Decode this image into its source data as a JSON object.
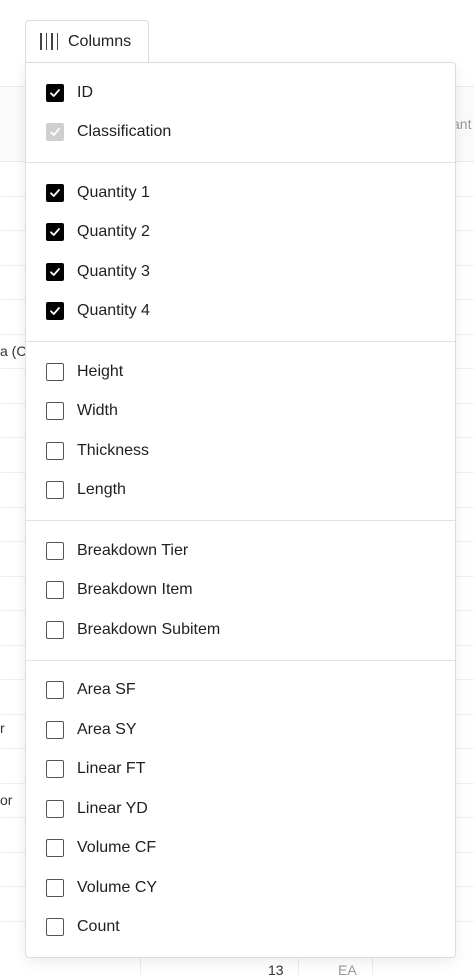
{
  "columns_button": {
    "label": "Columns",
    "icon": "columns-icon"
  },
  "background": {
    "header_fragment": "ant",
    "row_fragments": [
      "a (C",
      "r",
      "or"
    ],
    "footer_cells": [
      "13",
      "EA"
    ]
  },
  "menu": {
    "groups": [
      {
        "items": [
          {
            "label": "ID",
            "state": "checked"
          },
          {
            "label": "Classification",
            "state": "disabled"
          }
        ]
      },
      {
        "items": [
          {
            "label": "Quantity 1",
            "state": "checked"
          },
          {
            "label": "Quantity 2",
            "state": "checked"
          },
          {
            "label": "Quantity 3",
            "state": "checked"
          },
          {
            "label": "Quantity 4",
            "state": "checked"
          }
        ]
      },
      {
        "items": [
          {
            "label": "Height",
            "state": "unchecked"
          },
          {
            "label": "Width",
            "state": "unchecked"
          },
          {
            "label": "Thickness",
            "state": "unchecked"
          },
          {
            "label": "Length",
            "state": "unchecked"
          }
        ]
      },
      {
        "items": [
          {
            "label": "Breakdown Tier",
            "state": "unchecked"
          },
          {
            "label": "Breakdown Item",
            "state": "unchecked"
          },
          {
            "label": "Breakdown Subitem",
            "state": "unchecked"
          }
        ]
      },
      {
        "items": [
          {
            "label": "Area SF",
            "state": "unchecked"
          },
          {
            "label": "Area SY",
            "state": "unchecked"
          },
          {
            "label": "Linear FT",
            "state": "unchecked"
          },
          {
            "label": "Linear YD",
            "state": "unchecked"
          },
          {
            "label": "Volume CF",
            "state": "unchecked"
          },
          {
            "label": "Volume CY",
            "state": "unchecked"
          },
          {
            "label": "Count",
            "state": "unchecked"
          }
        ]
      }
    ]
  },
  "colors": {
    "checked": "#000000",
    "disabled": "#cfcfcf",
    "border": "#dcdcdc"
  }
}
